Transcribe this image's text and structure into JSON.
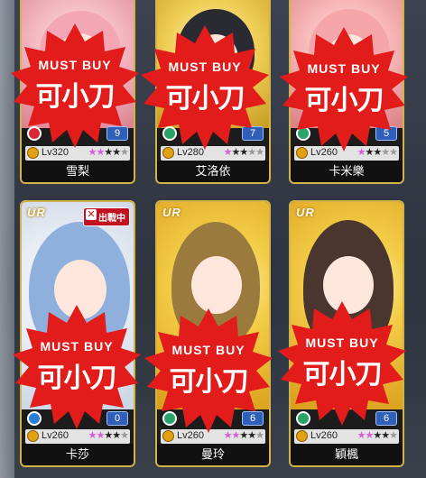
{
  "cards": [
    {
      "name": "雪梨",
      "level": "Lv320",
      "count": "9",
      "rarity": "",
      "deployed": "",
      "elem_color": "#d8283a"
    },
    {
      "name": "艾洛依",
      "level": "Lv280",
      "count": "7",
      "rarity": "",
      "deployed": "",
      "elem_color": "#2aa36b"
    },
    {
      "name": "卡米樂",
      "level": "Lv260",
      "count": "5",
      "rarity": "",
      "deployed": "",
      "elem_color": "#2aa36b"
    },
    {
      "name": "卡莎",
      "level": "Lv260",
      "count": "0",
      "rarity": "UR",
      "deployed": "出戰中",
      "elem_color": "#2b7ed8"
    },
    {
      "name": "曼玲",
      "level": "Lv260",
      "count": "6",
      "rarity": "UR",
      "deployed": "",
      "elem_color": "#2aa36b"
    },
    {
      "name": "穎楓",
      "level": "Lv260",
      "count": "6",
      "rarity": "UR",
      "deployed": "",
      "elem_color": "#2aa36b"
    }
  ],
  "stamp": {
    "top": "MUST BUY",
    "big": "可小刀",
    "color": "#e21b1b"
  },
  "icons": {
    "deploy": "crossed-swords-icon",
    "element": "element-icon",
    "level": "level-badge-icon",
    "star": "star-icon"
  }
}
